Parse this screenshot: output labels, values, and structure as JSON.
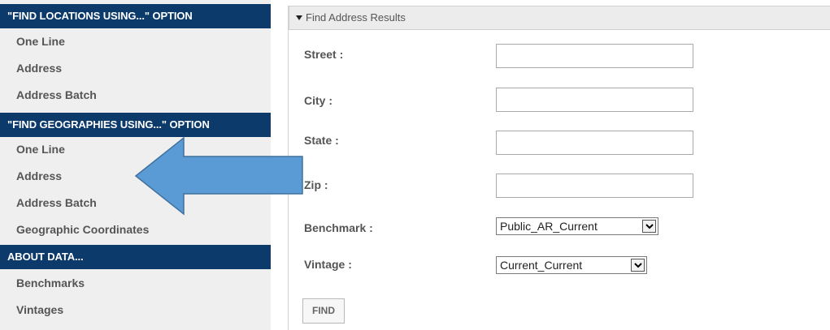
{
  "sidebar": {
    "sections": [
      {
        "header": "\"FIND LOCATIONS USING...\" OPTION",
        "items": [
          "One Line",
          "Address",
          "Address Batch"
        ]
      },
      {
        "header": "\"FIND GEOGRAPHIES USING...\" OPTION",
        "items": [
          "One Line",
          "Address",
          "Address Batch",
          "Geographic Coordinates"
        ]
      },
      {
        "header": "ABOUT DATA...",
        "items": [
          "Benchmarks",
          "Vintages"
        ]
      }
    ]
  },
  "main": {
    "results_header": "Find Address Results",
    "fields": {
      "street": {
        "label": "Street :",
        "value": ""
      },
      "city": {
        "label": "City :",
        "value": ""
      },
      "state": {
        "label": "State :",
        "value": ""
      },
      "zip": {
        "label": "Zip :",
        "value": ""
      }
    },
    "benchmark": {
      "label": "Benchmark :",
      "value": "Public_AR_Current"
    },
    "vintage": {
      "label": "Vintage :",
      "value": "Current_Current"
    },
    "find_label": "FIND"
  },
  "colors": {
    "header_bg": "#0c3a6b",
    "sidebar_bg": "#efefef",
    "arrow_fill": "#5b9bd5",
    "arrow_stroke": "#41719c"
  }
}
